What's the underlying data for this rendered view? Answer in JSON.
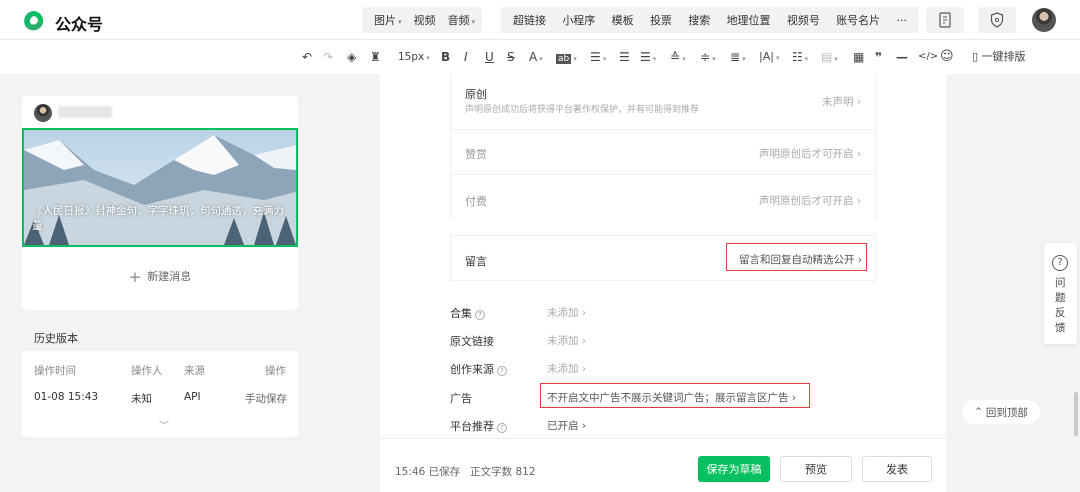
{
  "app": {
    "brand": "公众号"
  },
  "topbar": {
    "group1": [
      {
        "label": "图片",
        "caret": true
      },
      {
        "label": "视频",
        "caret": false
      },
      {
        "label": "音频",
        "caret": true
      }
    ],
    "group2": [
      "超链接",
      "小程序",
      "模板",
      "投票",
      "搜索",
      "地理位置",
      "视频号",
      "账号名片",
      "···"
    ]
  },
  "toolbar": {
    "undo": "↶",
    "redo": "↷",
    "font_size": "15px",
    "bold": "B",
    "italic": "I",
    "underline": "U",
    "strike": "S",
    "text_color": "A",
    "bg_color": "ab",
    "quote": "❞",
    "divider": "—",
    "code": "</>",
    "emoji": "☺",
    "one_click": "一键排版"
  },
  "left": {
    "cover_title": "《人民日报》封神金句，字字珠玑，句句通透，充满力量",
    "new_message": "新建消息",
    "history_title": "历史版本",
    "history_headers": [
      "操作时间",
      "操作人",
      "来源",
      "操作"
    ],
    "history_rows": [
      {
        "time": "01-08 15:43",
        "user": "未知",
        "source": "API",
        "action": "手动保存"
      }
    ]
  },
  "settings": {
    "original": {
      "label": "原创",
      "desc": "声明原创成功后将获得平台著作权保护，并有可能得到推荐",
      "value": "未声明"
    },
    "reward": {
      "label": "赞赏",
      "value": "声明原创后才可开启"
    },
    "paid": {
      "label": "付费",
      "value": "声明原创后才可开启"
    },
    "comment": {
      "label": "留言",
      "value": "留言和回复自动精选公开"
    },
    "collection": {
      "label": "合集",
      "value": "未添加"
    },
    "source_link": {
      "label": "原文链接",
      "value": "未添加"
    },
    "creation_source": {
      "label": "创作来源",
      "value": "未添加"
    },
    "ads": {
      "label": "广告",
      "value": "不开启文中广告不展示关键词广告；展示留言区广告"
    },
    "platform": {
      "label": "平台推荐",
      "value": "已开启"
    }
  },
  "bottom": {
    "time": "15:46",
    "saved": "已保存",
    "wordcount_label": "正文字数",
    "wordcount": "812",
    "save_draft": "保存为草稿",
    "preview": "预览",
    "publish": "发表"
  },
  "side": {
    "feedback": "问题反馈",
    "back_to_top": "回到顶部"
  },
  "colors": {
    "accent": "#07c160",
    "highlight_box": "#e0393e"
  }
}
